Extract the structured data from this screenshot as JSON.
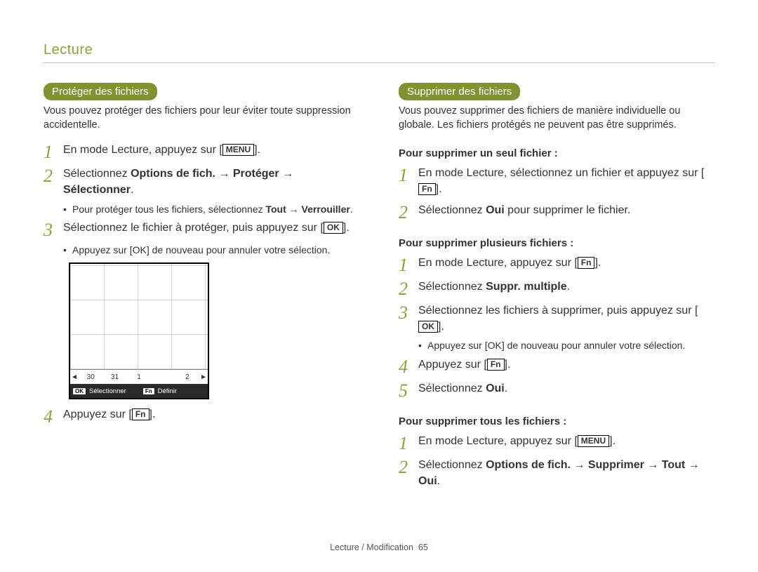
{
  "header": "Lecture",
  "footer": {
    "section": "Lecture / Modification",
    "page": "65"
  },
  "keys": {
    "menu": "MENU",
    "ok": "OK",
    "fn": "Fn"
  },
  "left": {
    "pill": "Protéger des fichiers",
    "intro": "Vous pouvez protéger des fichiers pour leur éviter toute suppression accidentelle.",
    "s1_pre": "En mode Lecture, appuyez sur [",
    "s1_post": "].",
    "s2_a": "Sélectionnez ",
    "s2_b": "Options de fich.",
    "s2_c": " → ",
    "s2_d": "Protéger",
    "s2_e": " → ",
    "s2_f": "Sélectionner",
    "s2_g": ".",
    "s2_bullet_pre": "Pour protéger tous les fichiers, sélectionnez ",
    "s2_bullet_b1": "Tout",
    "s2_bullet_mid": " → ",
    "s2_bullet_b2": "Verrouiller",
    "s2_bullet_post": ".",
    "s3_pre": "Sélectionnez le fichier à protéger, puis appuyez sur [",
    "s3_post": "].",
    "s3_bullet_pre": "Appuyez sur [",
    "s3_bullet_post": "] de nouveau pour annuler votre sélection.",
    "s4_pre": "Appuyez sur [",
    "s4_post": "]."
  },
  "screen": {
    "dates": [
      "30",
      "31",
      "1",
      "2"
    ],
    "bot": {
      "ok_label": "Sélectionner",
      "fn_label": "Définir"
    }
  },
  "right": {
    "pill": "Supprimer des fichiers",
    "intro": "Vous pouvez supprimer des fichiers de manière individuelle ou globale. Les fichiers protégés ne peuvent pas être supprimés.",
    "sec1_head": "Pour supprimer un seul fichier :",
    "sec1_s1_pre": "En mode Lecture, sélectionnez un fichier et appuyez sur [",
    "sec1_s1_post": "].",
    "sec1_s2_a": "Sélectionnez ",
    "sec1_s2_b": "Oui",
    "sec1_s2_c": " pour supprimer le fichier.",
    "sec2_head": "Pour supprimer plusieurs fichiers :",
    "sec2_s1_pre": "En mode Lecture, appuyez sur [",
    "sec2_s1_post": "].",
    "sec2_s2_a": "Sélectionnez ",
    "sec2_s2_b": "Suppr. multiple",
    "sec2_s2_c": ".",
    "sec2_s3_pre": "Sélectionnez les fichiers à supprimer, puis appuyez sur [",
    "sec2_s3_post": "].",
    "sec2_s3_bullet_pre": "Appuyez sur [",
    "sec2_s3_bullet_post": "] de nouveau pour annuler votre sélection.",
    "sec2_s4_pre": "Appuyez sur [",
    "sec2_s4_post": "].",
    "sec2_s5_a": "Sélectionnez ",
    "sec2_s5_b": "Oui",
    "sec2_s5_c": ".",
    "sec3_head": "Pour supprimer tous les fichiers :",
    "sec3_s1_pre": "En mode Lecture, appuyez sur [",
    "sec3_s1_post": "].",
    "sec3_s2_a": "Sélectionnez ",
    "sec3_s2_b": "Options de fich.",
    "sec3_s2_c": " → ",
    "sec3_s2_d": "Supprimer",
    "sec3_s2_e": " → ",
    "sec3_s2_f": "Tout",
    "sec3_s2_g": " → ",
    "sec3_s2_h": "Oui",
    "sec3_s2_i": "."
  }
}
